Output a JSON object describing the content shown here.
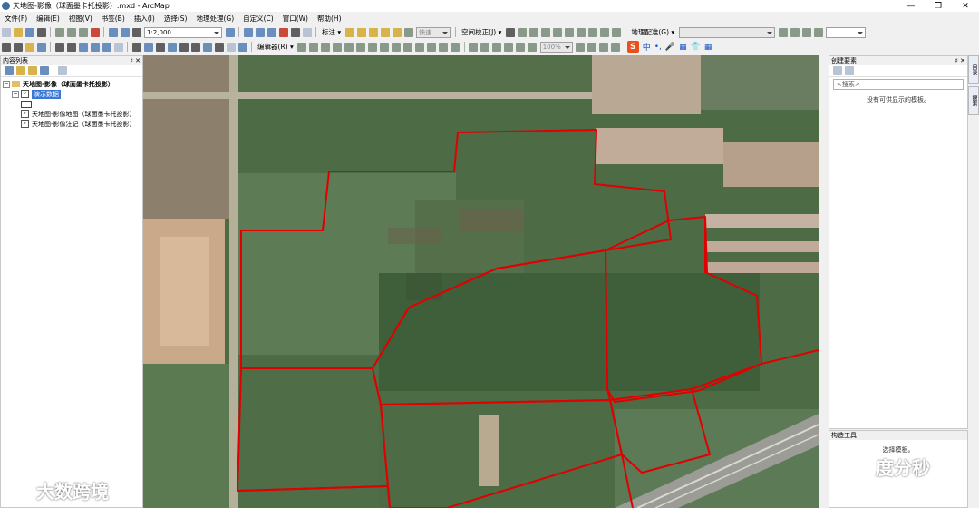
{
  "window": {
    "title": "天地图-影像（球面墨卡托投影）.mxd - ArcMap",
    "controls": [
      "—",
      "❐",
      "✕"
    ]
  },
  "menu": [
    "文件(F)",
    "编辑(E)",
    "视图(V)",
    "书签(B)",
    "插入(I)",
    "选择(S)",
    "地理处理(G)",
    "自定义(C)",
    "窗口(W)",
    "帮助(H)"
  ],
  "toolbar": {
    "scale": "1:2,000",
    "label_menu": "标注 ▾",
    "fast_combo": "快速",
    "spatial_adjust": "空间校正(J) ▾",
    "georef": "地理配准(G) ▾",
    "editor": "编辑器(R) ▾",
    "zoom": "100%",
    "sogou_items": [
      "中",
      "•,",
      "🎤",
      "▦",
      "👕",
      "▦"
    ]
  },
  "toc": {
    "header": "内容列表",
    "pin": "♯ ✕",
    "root": "天地图-影像（球面墨卡托投影）",
    "layers": [
      {
        "name": "演示数据",
        "selected": true
      },
      {
        "name": "天地图-影像地图（球面墨卡托投影）",
        "selected": false
      },
      {
        "name": "天地图-影像注记（球面墨卡托投影）",
        "selected": false
      }
    ]
  },
  "create_features": {
    "header": "创建要素",
    "pin": "♯ ✕",
    "search_placeholder": "<搜索>",
    "empty_text": "没有可供显示的模板。"
  },
  "construction": {
    "header": "构造工具",
    "empty_text": "选择模板。"
  },
  "side_tabs": [
    "目录",
    "搜索"
  ],
  "watermarks": {
    "left": "大数跨境",
    "right": "度分秒"
  },
  "colors": {
    "polygon_stroke": "#e00000",
    "selection": "#3a78d8"
  }
}
